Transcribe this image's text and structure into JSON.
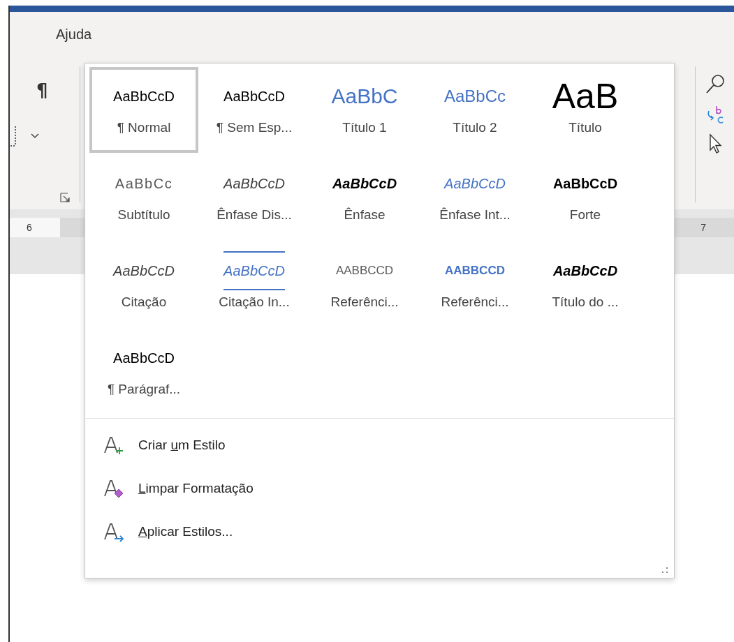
{
  "ribbon": {
    "tabs": [
      {
        "label": "Ajuda",
        "selected": false
      }
    ],
    "paragraph_mark": "¶"
  },
  "ruler": {
    "labels": [
      "6",
      "7"
    ]
  },
  "styles_gallery": {
    "styles": [
      {
        "sample": "AaBbCcD",
        "label": "¶ Normal",
        "kind": "normal",
        "selected": true
      },
      {
        "sample": "AaBbCcD",
        "label": "¶ Sem Esp...",
        "kind": "normal",
        "selected": false
      },
      {
        "sample": "AaBbC",
        "label": "Título 1",
        "kind": "heading1",
        "selected": false
      },
      {
        "sample": "AaBbCc",
        "label": "Título 2",
        "kind": "heading2",
        "selected": false
      },
      {
        "sample": "AaB",
        "label": "Título",
        "kind": "title",
        "selected": false
      },
      {
        "sample": "AaBbCc",
        "label": "Subtítulo",
        "kind": "subtitle",
        "selected": false
      },
      {
        "sample": "AaBbCcD",
        "label": "Ênfase Dis...",
        "kind": "subtle_emphasis",
        "selected": false
      },
      {
        "sample": "AaBbCcD",
        "label": "Ênfase",
        "kind": "emphasis",
        "selected": false
      },
      {
        "sample": "AaBbCcD",
        "label": "Ênfase Int...",
        "kind": "intense_emphasis",
        "selected": false
      },
      {
        "sample": "AaBbCcD",
        "label": "Forte",
        "kind": "strong",
        "selected": false
      },
      {
        "sample": "AaBbCcD",
        "label": "Citação",
        "kind": "quote",
        "selected": false
      },
      {
        "sample": "AaBbCcD",
        "label": "Citação In...",
        "kind": "intense_quote",
        "selected": false
      },
      {
        "sample": "AABBCCD",
        "label": "Referênci...",
        "kind": "subtle_reference",
        "selected": false
      },
      {
        "sample": "AABBCCD",
        "label": "Referênci...",
        "kind": "intense_reference",
        "selected": false
      },
      {
        "sample": "AaBbCcD",
        "label": "Título do ...",
        "kind": "book_title",
        "selected": false
      },
      {
        "sample": "AaBbCcD",
        "label": "¶ Parágraf...",
        "kind": "normal",
        "selected": false
      }
    ],
    "commands": [
      {
        "before": "Criar ",
        "access_key": "u",
        "after": "m Estilo",
        "kind": "create"
      },
      {
        "access_key": "L",
        "after": "impar Formatação",
        "kind": "clear"
      },
      {
        "access_key": "A",
        "after": "plicar Estilos...",
        "kind": "apply"
      }
    ]
  }
}
